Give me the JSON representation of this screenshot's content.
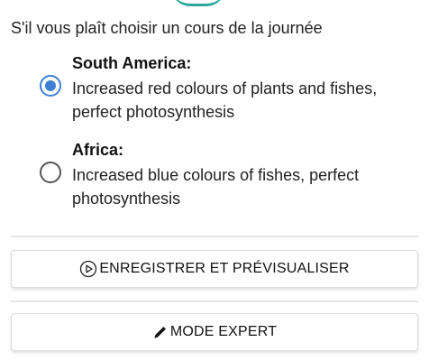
{
  "prompt": "S'il vous plaît choisir un cours de la journée",
  "options": [
    {
      "title": "South America:",
      "description": "Increased red colours of plants and fishes, perfect photosynthesis",
      "selected": true
    },
    {
      "title": "Africa:",
      "description": "Increased blue colours of fishes, perfect photosynthesis",
      "selected": false
    }
  ],
  "buttons": {
    "save_preview_label": "ENREGISTRER ET PRÉVISUALISER",
    "save_preview_icon": "play-circle-icon",
    "expert_mode_label": "MODE EXPERT",
    "expert_mode_icon": "pencil-icon"
  },
  "colors": {
    "radio_selected": "#3e7fd6",
    "radio_unselected": "#555555",
    "accent": "#2ba89b"
  }
}
